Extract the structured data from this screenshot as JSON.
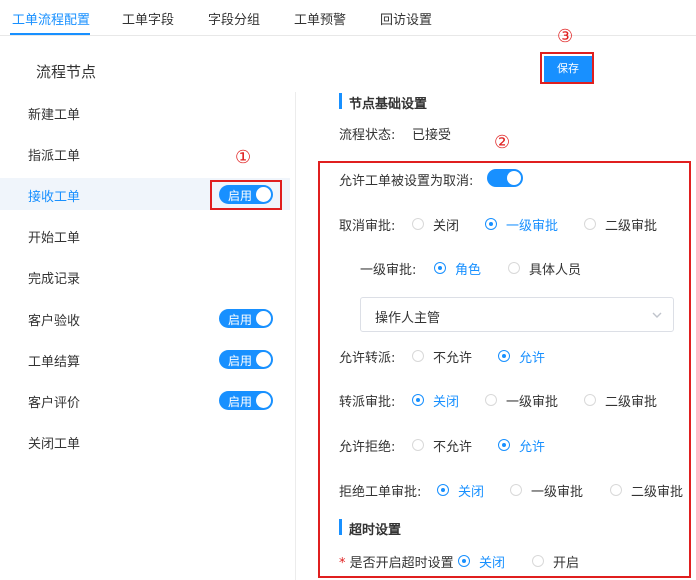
{
  "tabs": [
    {
      "label": "工单流程配置",
      "active": true
    },
    {
      "label": "工单字段",
      "active": false
    },
    {
      "label": "字段分组",
      "active": false
    },
    {
      "label": "工单预警",
      "active": false
    },
    {
      "label": "回访设置",
      "active": false
    }
  ],
  "page": {
    "section_title": "流程节点",
    "save_label": "保存"
  },
  "markers": [
    "①",
    "②",
    "③"
  ],
  "nodes": [
    {
      "label": "新建工单",
      "switch": null
    },
    {
      "label": "指派工单",
      "switch": null
    },
    {
      "label": "接收工单",
      "switch": "启用",
      "active": true
    },
    {
      "label": "开始工单",
      "switch": null
    },
    {
      "label": "完成记录",
      "switch": null
    },
    {
      "label": "客户验收",
      "switch": "启用"
    },
    {
      "label": "工单结算",
      "switch": "启用"
    },
    {
      "label": "客户评价",
      "switch": "启用"
    },
    {
      "label": "关闭工单",
      "switch": null
    }
  ],
  "settings": {
    "basic_heading": "节点基础设置",
    "status_label": "流程状态:",
    "status_value": "已接受",
    "allow_cancel_label": "允许工单被设置为取消:",
    "allow_cancel_on": true,
    "cancel_approval": {
      "label": "取消审批:",
      "options": [
        "关闭",
        "一级审批",
        "二级审批"
      ],
      "selected": 1
    },
    "level1_approval": {
      "label": "一级审批:",
      "options": [
        "角色",
        "具体人员"
      ],
      "selected": 0
    },
    "role_select": {
      "value": "操作人主管"
    },
    "allow_transfer": {
      "label": "允许转派:",
      "options": [
        "不允许",
        "允许"
      ],
      "selected": 1
    },
    "transfer_approval": {
      "label": "转派审批:",
      "options": [
        "关闭",
        "一级审批",
        "二级审批"
      ],
      "selected": 0
    },
    "allow_reject": {
      "label": "允许拒绝:",
      "options": [
        "不允许",
        "允许"
      ],
      "selected": 1
    },
    "reject_approval": {
      "label": "拒绝工单审批:",
      "options": [
        "关闭",
        "一级审批",
        "二级审批"
      ],
      "selected": 0
    },
    "timeout_heading": "超时设置",
    "timeout": {
      "required_mark": "*",
      "label": "是否开启超时设置",
      "options": [
        "关闭",
        "开启"
      ],
      "selected": 0
    }
  },
  "colors": {
    "accent": "#1890ff",
    "annotation_red": "#e01f1f"
  }
}
